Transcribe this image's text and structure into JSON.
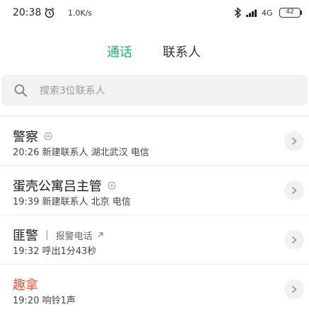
{
  "status_bar": {
    "time": "20:38",
    "net_speed": "1.0K/s",
    "net_type": "4G",
    "battery": "42"
  },
  "tabs": [
    {
      "label": "通话",
      "active": true
    },
    {
      "label": "联系人",
      "active": false
    }
  ],
  "search": {
    "placeholder": "搜索3位联系人"
  },
  "calls": [
    {
      "name": "警察",
      "detail": "20:26 新建联系人 湖北武汉 电信",
      "missed": false
    },
    {
      "name": "蛋壳公寓吕主管",
      "detail": "19:39 新建联系人 北京 电信",
      "missed": false
    },
    {
      "name": "匪警",
      "tag": "报警电话",
      "detail": "19:32 呼出1分43秒",
      "missed": false
    },
    {
      "name": "趣拿",
      "detail": "19:20 响铃1声",
      "missed": true
    }
  ],
  "colors": {
    "accent": "#1fb364",
    "missed": "#e05a3a"
  }
}
